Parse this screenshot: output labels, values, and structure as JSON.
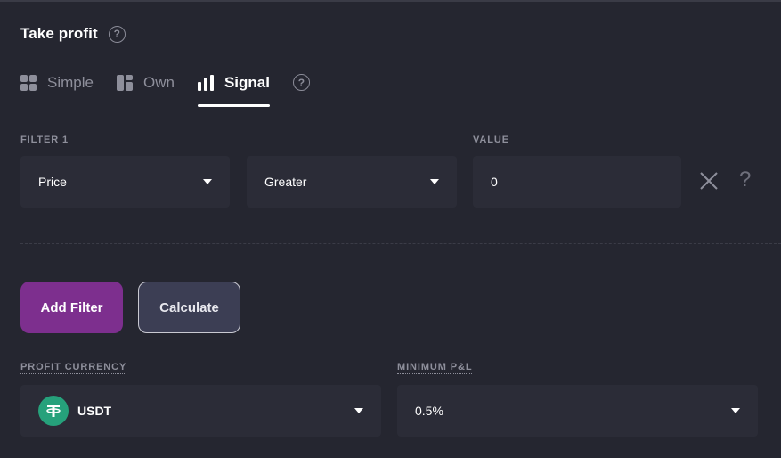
{
  "header": {
    "title": "Take profit",
    "help_glyph": "?"
  },
  "tabs": [
    {
      "label": "Simple",
      "icon": "grid-icon",
      "active": false
    },
    {
      "label": "Own",
      "icon": "layout-icon",
      "active": false
    },
    {
      "label": "Signal",
      "icon": "bar-chart-icon",
      "active": true
    }
  ],
  "tabs_help_glyph": "?",
  "filter": {
    "label": "FILTER 1",
    "value_label": "VALUE",
    "indicator": "Price",
    "operator": "Greater",
    "value": "0",
    "help_glyph": "?"
  },
  "actions": {
    "add_filter": "Add Filter",
    "calculate": "Calculate"
  },
  "profit_currency": {
    "label": "PROFIT CURRENCY",
    "value": "USDT",
    "icon": "tether-icon"
  },
  "minimum_pnl": {
    "label": "MINIMUM P&L",
    "value": "0.5%"
  },
  "colors": {
    "background": "#252630",
    "field_background": "#2b2c37",
    "primary_button": "#7d2f8e",
    "secondary_button": "#3c3e54",
    "tether_green": "#26a17b"
  }
}
